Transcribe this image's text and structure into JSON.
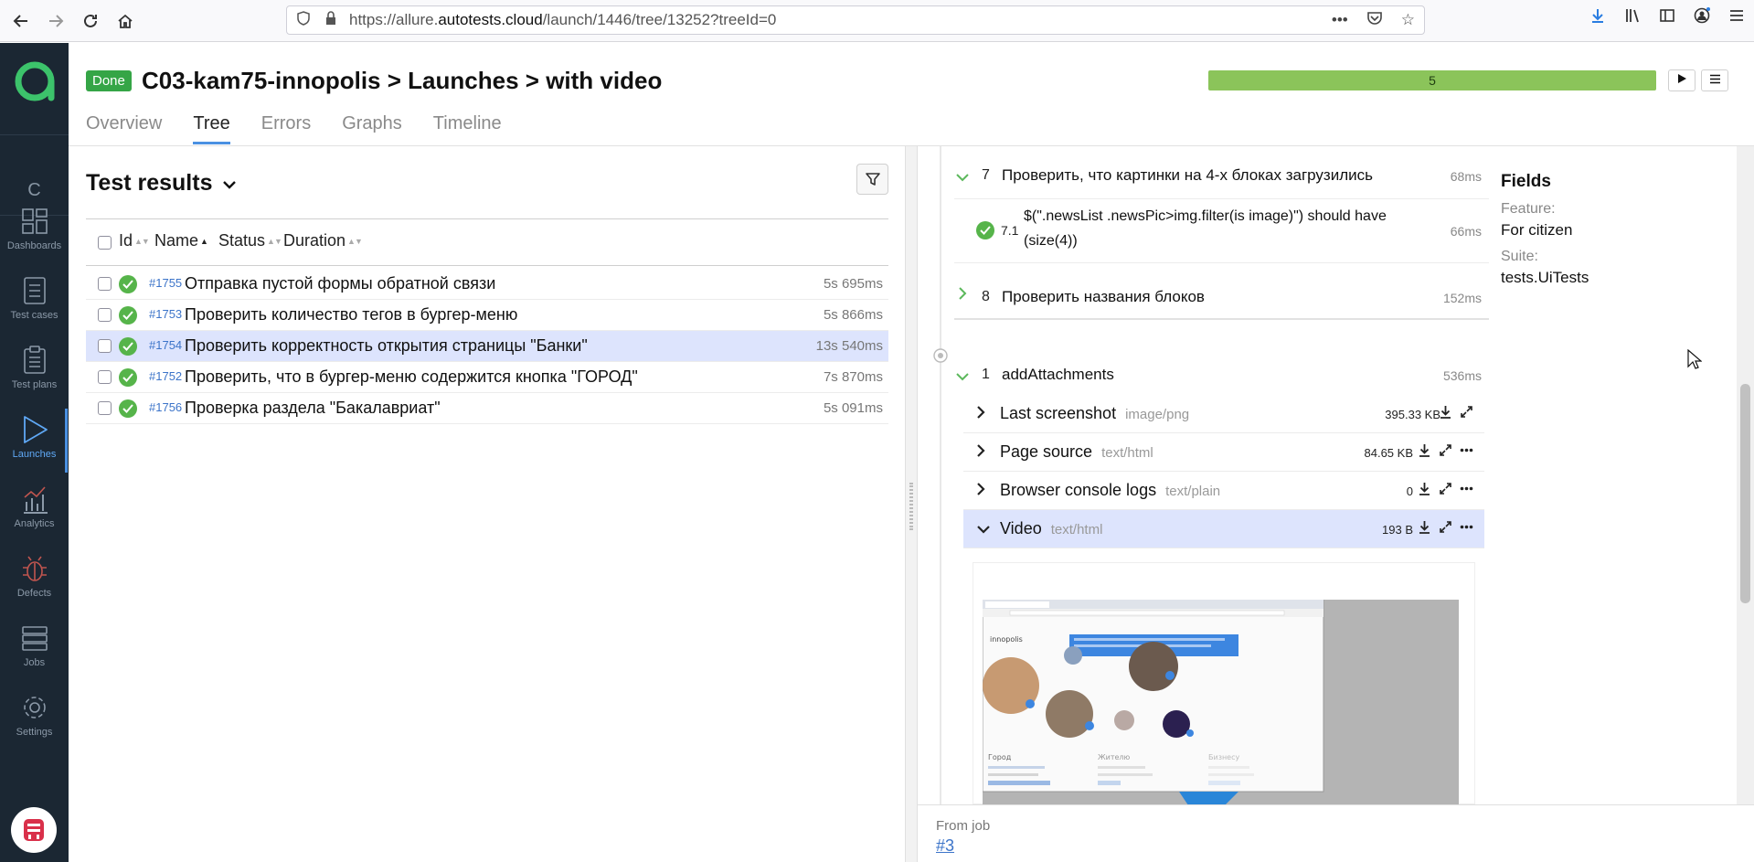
{
  "browser": {
    "url_prefix": "https://allure.",
    "url_domain": "autotests.cloud",
    "url_suffix": "/launch/1446/tree/13252?treeId=0"
  },
  "sidebar": {
    "collapsed_label": "C",
    "items": [
      {
        "label": "Dashboards",
        "icon": "dashboards-icon"
      },
      {
        "label": "Test cases",
        "icon": "test-cases-icon"
      },
      {
        "label": "Test plans",
        "icon": "test-plans-icon"
      },
      {
        "label": "Launches",
        "icon": "launches-icon"
      },
      {
        "label": "Analytics",
        "icon": "analytics-icon"
      },
      {
        "label": "Defects",
        "icon": "defects-icon"
      },
      {
        "label": "Jobs",
        "icon": "jobs-icon"
      },
      {
        "label": "Settings",
        "icon": "settings-icon"
      }
    ],
    "active": "Launches"
  },
  "header": {
    "status_badge": "Done",
    "project": "C03-kam75-innopolis",
    "section": "Launches",
    "launch": "with video",
    "progress_value": "5",
    "tabs": [
      "Overview",
      "Tree",
      "Errors",
      "Graphs",
      "Timeline"
    ],
    "active_tab": "Tree"
  },
  "results": {
    "title": "Test results",
    "columns": [
      "Id",
      "Name",
      "Status",
      "Duration"
    ],
    "rows": [
      {
        "id": "#1755",
        "name": "Отправка пустой формы обратной связи",
        "duration": "5s 695ms",
        "selected": false
      },
      {
        "id": "#1753",
        "name": "Проверить количество тегов в бургер-меню",
        "duration": "5s 866ms",
        "selected": false
      },
      {
        "id": "#1754",
        "name": "Проверить корректность открытия страницы \"Банки\"",
        "duration": "13s 540ms",
        "selected": true
      },
      {
        "id": "#1752",
        "name": "Проверить, что в бургер-меню содержится кнопка \"ГОРОД\"",
        "duration": "7s 870ms",
        "selected": false
      },
      {
        "id": "#1756",
        "name": "Проверка раздела \"Бакалавриат\"",
        "duration": "5s 091ms",
        "selected": false
      }
    ]
  },
  "steps": [
    {
      "num": "7",
      "name": "Проверить, что картинки на 4-х блоках загрузились",
      "duration": "68ms"
    },
    {
      "num": "7.1",
      "name_line1": "$(\".newsList .newsPic>img.filter(is image)\") should have",
      "name_line2": "(size(4))",
      "duration": "66ms"
    },
    {
      "num": "8",
      "name": "Проверить названия блоков",
      "duration": "152ms"
    },
    {
      "num": "1",
      "name": "addAttachments",
      "duration": "536ms"
    }
  ],
  "attachments": [
    {
      "name": "Last screenshot",
      "type": "image/png",
      "size": "395.33 KB"
    },
    {
      "name": "Page source",
      "type": "text/html",
      "size": "84.65 KB"
    },
    {
      "name": "Browser console logs",
      "type": "text/plain",
      "size": "0"
    },
    {
      "name": "Video",
      "type": "text/html",
      "size": "193 B"
    }
  ],
  "fields": {
    "title": "Fields",
    "feature_label": "Feature:",
    "feature_value": "For citizen",
    "suite_label": "Suite:",
    "suite_value": "tests.UiTests"
  },
  "footer": {
    "label": "From job",
    "link": "#3"
  },
  "colors": {
    "sidebar_bg": "#1b2733",
    "accent": "#4a90e2",
    "passed": "#56b44a",
    "progress": "#8bc45a",
    "selected_row": "#dde4fd"
  },
  "video_preview": {
    "logo_text": "innopolis",
    "col1": "Город",
    "col2": "Жителю",
    "col3": "Бизнесу"
  }
}
